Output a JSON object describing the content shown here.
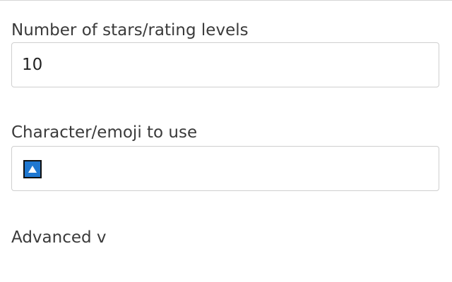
{
  "form": {
    "rating_levels": {
      "label": "Number of stars/rating levels",
      "value": "10"
    },
    "character": {
      "label": "Character/emoji to use",
      "value_icon": "blue-up-triangle-emoji-icon",
      "icon_color": "#1f78d1"
    },
    "advanced_toggle": {
      "label": "Advanced v"
    }
  }
}
